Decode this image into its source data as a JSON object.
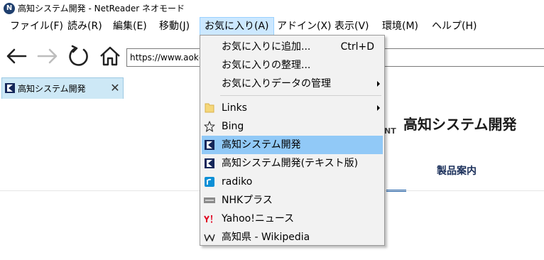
{
  "window": {
    "title": "高知システム開発 - NetReader ネオモード",
    "app_icon_letter": "N"
  },
  "menubar": {
    "items": [
      {
        "label": "ファイル(F)"
      },
      {
        "label": "読み(R)"
      },
      {
        "label": "編集(E)"
      },
      {
        "label": "移動(J)"
      },
      {
        "label": "お気に入り(A)"
      },
      {
        "label": "アドイン(X)"
      },
      {
        "label": "表示(V)"
      },
      {
        "label": "環境(M)"
      },
      {
        "label": "ヘルプ(H)"
      }
    ],
    "active_index": 4
  },
  "toolbar": {
    "url": "https://www.aok-net.com/"
  },
  "tab": {
    "label": "高知システム開発",
    "close_glyph": "✕"
  },
  "page": {
    "company_name": "高知システム開発",
    "header_fragment": "NT",
    "products_link": "製品案内"
  },
  "favorites_menu": {
    "items": [
      {
        "label": "お気に入りに追加...",
        "shortcut": "Ctrl+D",
        "icon": "",
        "submenu": false
      },
      {
        "label": "お気に入りの整理...",
        "shortcut": "",
        "icon": "",
        "submenu": false
      },
      {
        "label": "お気に入りデータの管理",
        "shortcut": "",
        "icon": "",
        "submenu": true
      },
      {
        "label": "Links",
        "shortcut": "",
        "icon": "folder-icon",
        "submenu": true
      },
      {
        "label": "Bing",
        "shortcut": "",
        "icon": "star-icon",
        "submenu": false
      },
      {
        "label": "高知システム開発",
        "shortcut": "",
        "icon": "aok-logo-icon",
        "submenu": false,
        "highlighted": true
      },
      {
        "label": "高知システム開発(テキスト版)",
        "shortcut": "",
        "icon": "aok-logo-icon",
        "submenu": false
      },
      {
        "label": "radiko",
        "shortcut": "",
        "icon": "radiko-icon",
        "submenu": false
      },
      {
        "label": "NHKプラス",
        "shortcut": "",
        "icon": "nhk-icon",
        "submenu": false
      },
      {
        "label": "Yahoo!ニュース",
        "shortcut": "",
        "icon": "yahoo-icon",
        "submenu": false
      },
      {
        "label": "高知県 - Wikipedia",
        "shortcut": "",
        "icon": "wikipedia-icon",
        "submenu": false
      }
    ]
  },
  "colors": {
    "menu_active_bg": "#cce8ff",
    "highlight_bg": "#91c9f7",
    "tab_bg": "#cde8f6",
    "accent_blue": "#1e5fa8"
  }
}
